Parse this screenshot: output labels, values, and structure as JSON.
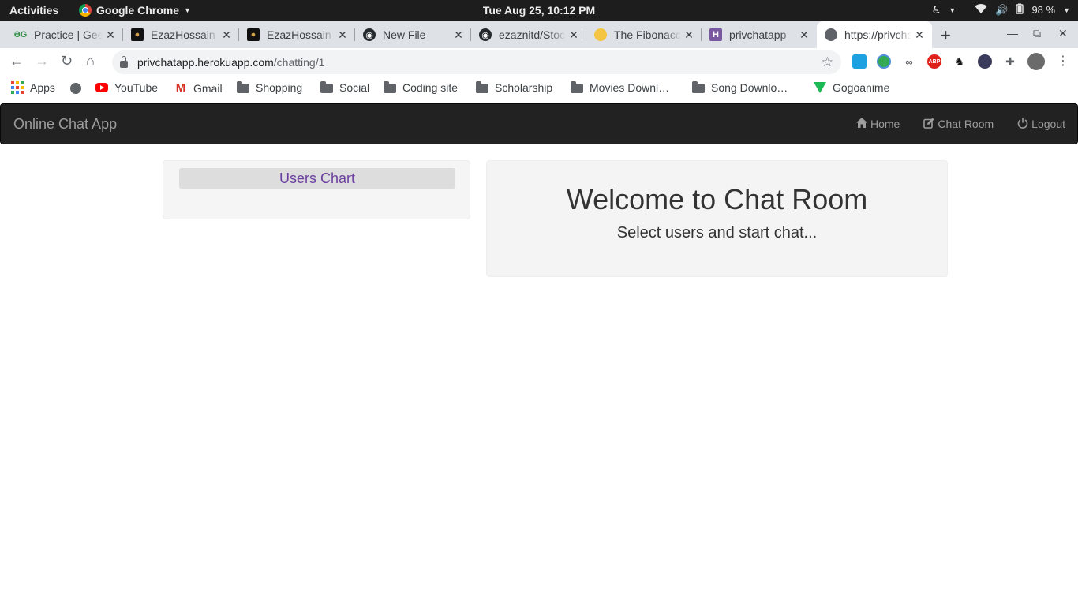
{
  "system": {
    "activities": "Activities",
    "app_name": "Google Chrome",
    "clock": "Tue Aug 25, 10:12 PM",
    "battery": "98 %"
  },
  "tabs": [
    {
      "title": "Practice | GeeksforGeeks",
      "favicon": "gfg-icon"
    },
    {
      "title": "EzazHossain",
      "favicon": "profile-icon"
    },
    {
      "title": "EzazHossain",
      "favicon": "profile-icon"
    },
    {
      "title": "New File",
      "favicon": "github-icon"
    },
    {
      "title": "ezaznitd/Stock",
      "favicon": "github-icon"
    },
    {
      "title": "The Fibonacci",
      "favicon": "emoji-icon"
    },
    {
      "title": "privchatapp",
      "favicon": "heroku-icon"
    },
    {
      "title": "https://privchatapp.herokuapp.com",
      "favicon": "globe-icon"
    }
  ],
  "address_bar": {
    "host": "privchatapp.herokuapp.com",
    "path": "/chatting/1"
  },
  "bookmarks": [
    {
      "label": "Apps",
      "icon": "apps-grid-icon"
    },
    {
      "label": "",
      "icon": "globe-icon"
    },
    {
      "label": "YouTube",
      "icon": "youtube-icon"
    },
    {
      "label": "Gmail",
      "icon": "gmail-icon"
    },
    {
      "label": "Shopping",
      "icon": "folder-icon"
    },
    {
      "label": "Social",
      "icon": "folder-icon"
    },
    {
      "label": "Coding site",
      "icon": "folder-icon"
    },
    {
      "label": "Scholarship",
      "icon": "folder-icon"
    },
    {
      "label": "Movies Downl…",
      "icon": "folder-icon"
    },
    {
      "label": "Song Downlo…",
      "icon": "folder-icon"
    },
    {
      "label": "Gogoanime",
      "icon": "gogoanime-icon"
    }
  ],
  "navbar": {
    "brand": "Online Chat App",
    "links": [
      {
        "label": "Home",
        "icon": "home-icon"
      },
      {
        "label": "Chat Room",
        "icon": "edit-icon"
      },
      {
        "label": "Logout",
        "icon": "power-icon"
      }
    ]
  },
  "users_panel": {
    "title": "Users Chart"
  },
  "welcome": {
    "title": "Welcome to Chat Room",
    "subtitle": "Select users and start chat..."
  },
  "colors": {
    "navbar_bg": "#222222",
    "navbar_text": "#9d9d9d",
    "users_title": "#6b3fa0",
    "panel_bg": "#f4f4f4"
  }
}
